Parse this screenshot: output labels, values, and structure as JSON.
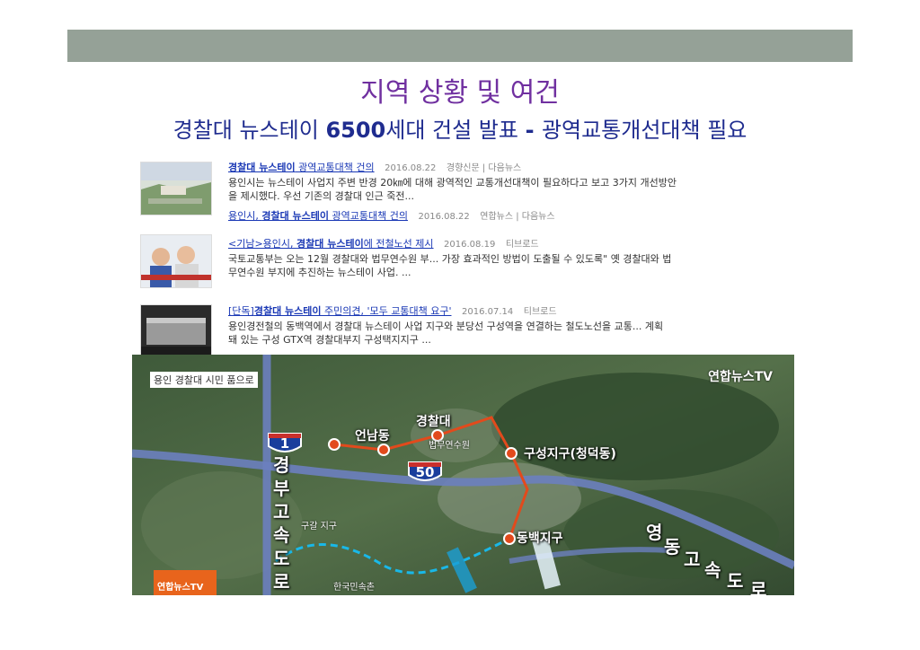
{
  "header": {
    "title": "지역 상황 및 여건",
    "subtitle_a": "경찰대 뉴스테이 ",
    "subtitle_num": "6500",
    "subtitle_b": "세대 건설 발표 ",
    "subtitle_dash": "- ",
    "subtitle_c": "광역교통개선대책 필요"
  },
  "news": [
    {
      "headline_bold": "경찰대 뉴스테이",
      "headline_rest": " 광역교통대책 건의",
      "date": "2016.08.22",
      "source": "경향신문 | 다음뉴스",
      "desc1": "용인시는 뉴스테이 사업지 주변 반경 20㎞에 대해 광역적인 교통개선대책이 필요하다고 보고 3가지 개선방안",
      "desc2": "을 제시했다. 우선 기존의 경찰대 인근 죽전...",
      "sub_headline_a": "용인시, ",
      "sub_headline_bold": "경찰대 뉴스테이",
      "sub_headline_rest": " 광역교통대책 건의",
      "sub_date": "2016.08.22",
      "sub_source": "연합뉴스 | 다음뉴스"
    },
    {
      "headline_a": "<기남>용인시, ",
      "headline_bold": "경찰대 뉴스테이",
      "headline_rest": "에 전철노선 제시",
      "date": "2016.08.19",
      "source": "티브로드",
      "desc1": "국토교통부는 오는 12월 경찰대와 법무연수원 부... 가장 효과적인 방법이 도출될 수 있도록\" 옛 경찰대와 법",
      "desc2": "무연수원 부지에 추진하는 뉴스테이 사업. ..."
    },
    {
      "headline_a": "[단독]",
      "headline_bold": "경찰대 뉴스테이",
      "headline_rest": " 주민의견, '모두 교통대책 요구'",
      "date": "2016.07.14",
      "source": "티브로드",
      "desc1": "용인경전철의 동백역에서 경찰대 뉴스테이 사업 지구와 분당선 구성역을 연결하는 철도노선을 교통... 계획",
      "desc2": "돼 있는 구성 GTX역 경찰대부지 구성택지지구 ..."
    }
  ],
  "map": {
    "caption": "용인 경찰대 시민 품으로",
    "brand": "연합뉴스TV",
    "logo": "연합뉴스TV",
    "labels": {
      "gyeongchal": "경찰대",
      "eonnam": "언남동",
      "beommu": "법무연수원",
      "guseong": "구성지구(청덕동)",
      "dongbaek": "동백지구",
      "gugal": "구갈 지구",
      "minsokchon": "한국민속촌"
    },
    "highway_gyeongbu": [
      "경",
      "부",
      "고",
      "속",
      "도",
      "로"
    ],
    "highway_yeongdong": [
      "영",
      "동",
      "고",
      "속",
      "도",
      "로"
    ],
    "shield_1": "1",
    "shield_50": "50",
    "colors": {
      "route": "#e24a1c",
      "route_alt": "#19b8e8",
      "highway": "#6b7fbf"
    }
  },
  "colors": {
    "top_bar": "#95a197",
    "title": "#7030a0",
    "subtitle": "#1f2c8f",
    "link": "#1a38b5"
  }
}
